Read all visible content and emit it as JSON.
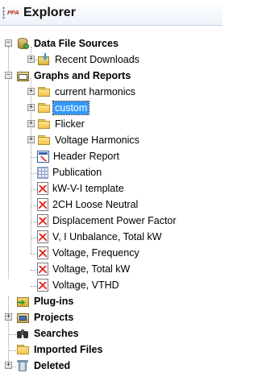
{
  "panel": {
    "logo": "ᴘᴘᴀ",
    "title": "Explorer"
  },
  "tree": {
    "data_file_sources": {
      "label": "Data File Sources",
      "children": {
        "recent_downloads": "Recent Downloads"
      }
    },
    "graphs_and_reports": {
      "label": "Graphs and Reports",
      "folders": [
        "current harmonics",
        "custom",
        "Flicker",
        "Voltage Harmonics"
      ],
      "selected_folder": "custom",
      "reports": [
        "Header Report",
        "Publication",
        " kW-V-I  template",
        "2CH Loose Neutral",
        "Displacement Power Factor",
        "V, I Unbalance, Total kW",
        "Voltage, Frequency",
        "Voltage, Total kW",
        "Voltage, VTHD"
      ]
    },
    "plug_ins": "Plug-ins",
    "projects": "Projects",
    "searches": "Searches",
    "imported_files": "Imported Files",
    "deleted": "Deleted"
  },
  "icons": {
    "data_file_sources": "database-icon",
    "recent_downloads": "download-folder-icon",
    "graphs_and_reports": "graph-folder-icon",
    "folder": "folder-icon",
    "header_report": "report-icon",
    "publication": "publication-icon",
    "graph": "graph-doc-icon",
    "plug_ins": "plugin-icon",
    "projects": "projects-icon",
    "searches": "binoculars-icon",
    "imported_files": "folder-icon",
    "deleted": "trash-icon"
  },
  "colors": {
    "selection": "#3399ff",
    "title_logo": "#c0392b"
  }
}
